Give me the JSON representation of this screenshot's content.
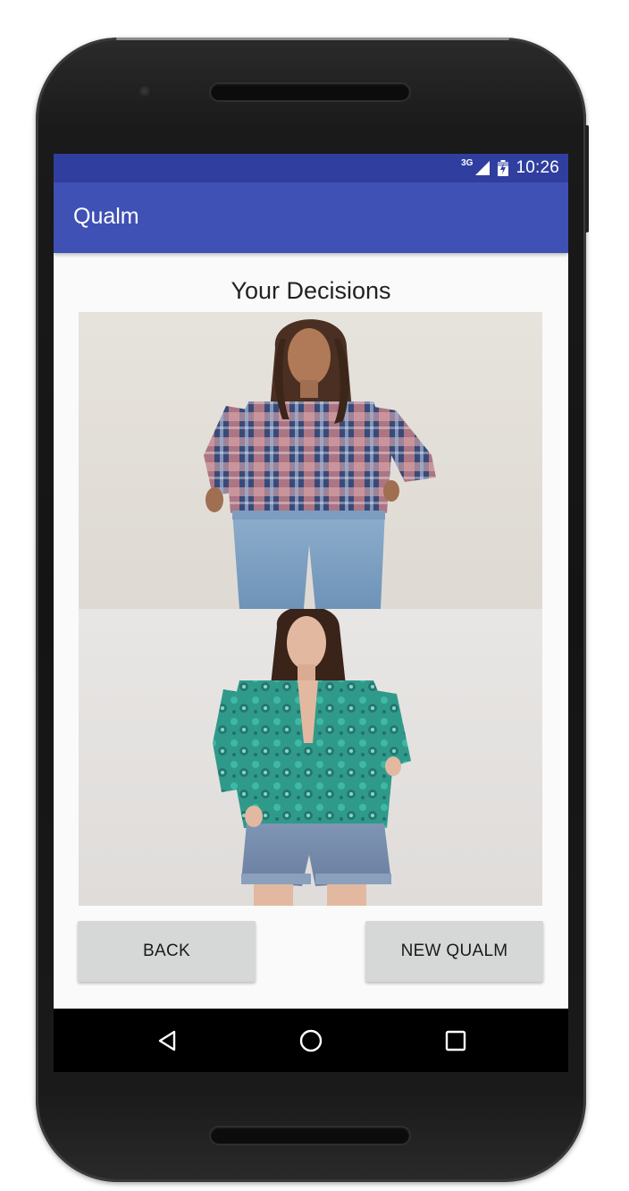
{
  "status_bar": {
    "network": "3G",
    "time": "10:26",
    "signal_icon": "cell-signal-icon",
    "battery_icon": "battery-charging-icon"
  },
  "app_bar": {
    "title": "Qualm",
    "color": "#3f51b5",
    "status_color": "#303f9f"
  },
  "content": {
    "heading": "Your Decisions",
    "images": [
      {
        "name": "decision-image-plaid-shirt",
        "description_icon": "photo-icon"
      },
      {
        "name": "decision-image-paisley-shirt",
        "description_icon": "photo-icon"
      }
    ]
  },
  "buttons": {
    "back_label": "BACK",
    "new_qualm_label": "NEW QUALM"
  },
  "nav": {
    "back_icon": "triangle-back-icon",
    "home_icon": "circle-home-icon",
    "recents_icon": "square-recents-icon"
  }
}
